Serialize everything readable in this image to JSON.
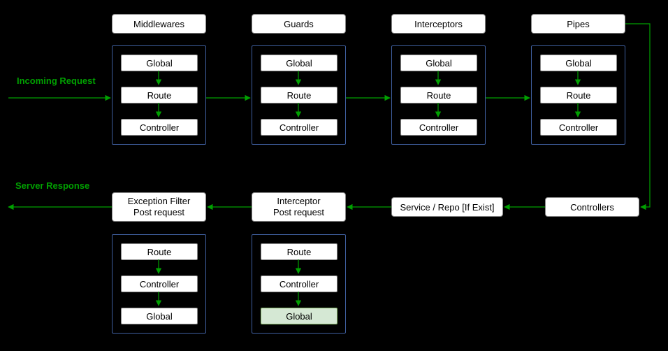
{
  "labels": {
    "incoming": "Incoming Request",
    "response": "Server Response"
  },
  "top": {
    "middlewares": {
      "title": "Middlewares",
      "items": [
        "Global",
        "Route",
        "Controller"
      ]
    },
    "guards": {
      "title": "Guards",
      "items": [
        "Global",
        "Route",
        "Controller"
      ]
    },
    "interceptors": {
      "title": "Interceptors",
      "items": [
        "Global",
        "Route",
        "Controller"
      ]
    },
    "pipes": {
      "title": "Pipes",
      "items": [
        "Global",
        "Route",
        "Controller"
      ]
    }
  },
  "bottom": {
    "controllers": {
      "title": "Controllers"
    },
    "service": {
      "title": "Service / Repo [If Exist]"
    },
    "interceptor_post": {
      "title_l1": "Interceptor",
      "title_l2": "Post request",
      "items": [
        "Route",
        "Controller",
        "Global"
      ],
      "hl_index": 2
    },
    "exception_filter": {
      "title_l1": "Exception Filter",
      "title_l2": "Post request",
      "items": [
        "Route",
        "Controller",
        "Global"
      ]
    }
  }
}
